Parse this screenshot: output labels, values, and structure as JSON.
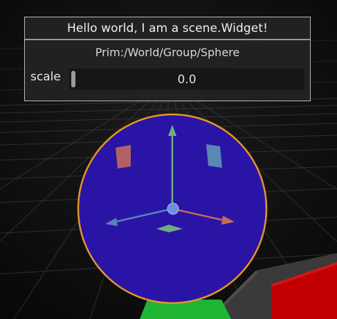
{
  "widget": {
    "title": "Hello world, I am a scene.Widget!",
    "prim_path": "Prim:/World/Group/Sphere",
    "scale_label": "scale",
    "scale_value": "0.0",
    "scale_fraction": 0.0
  },
  "colors": {
    "sphere_fill": "#2a14a6",
    "sphere_outline": "#e59728",
    "axis_y": "#6fae7e",
    "axis_x": "#c86a58",
    "axis_z": "#5b7fc0",
    "plane_xy": "#c0695c",
    "plane_yz": "#5f93b8",
    "plane_xz": "#72b57a",
    "ground_object": "#1fb533",
    "red_cube": "#c00000"
  },
  "icons": [
    "translate-gizmo-icon"
  ]
}
